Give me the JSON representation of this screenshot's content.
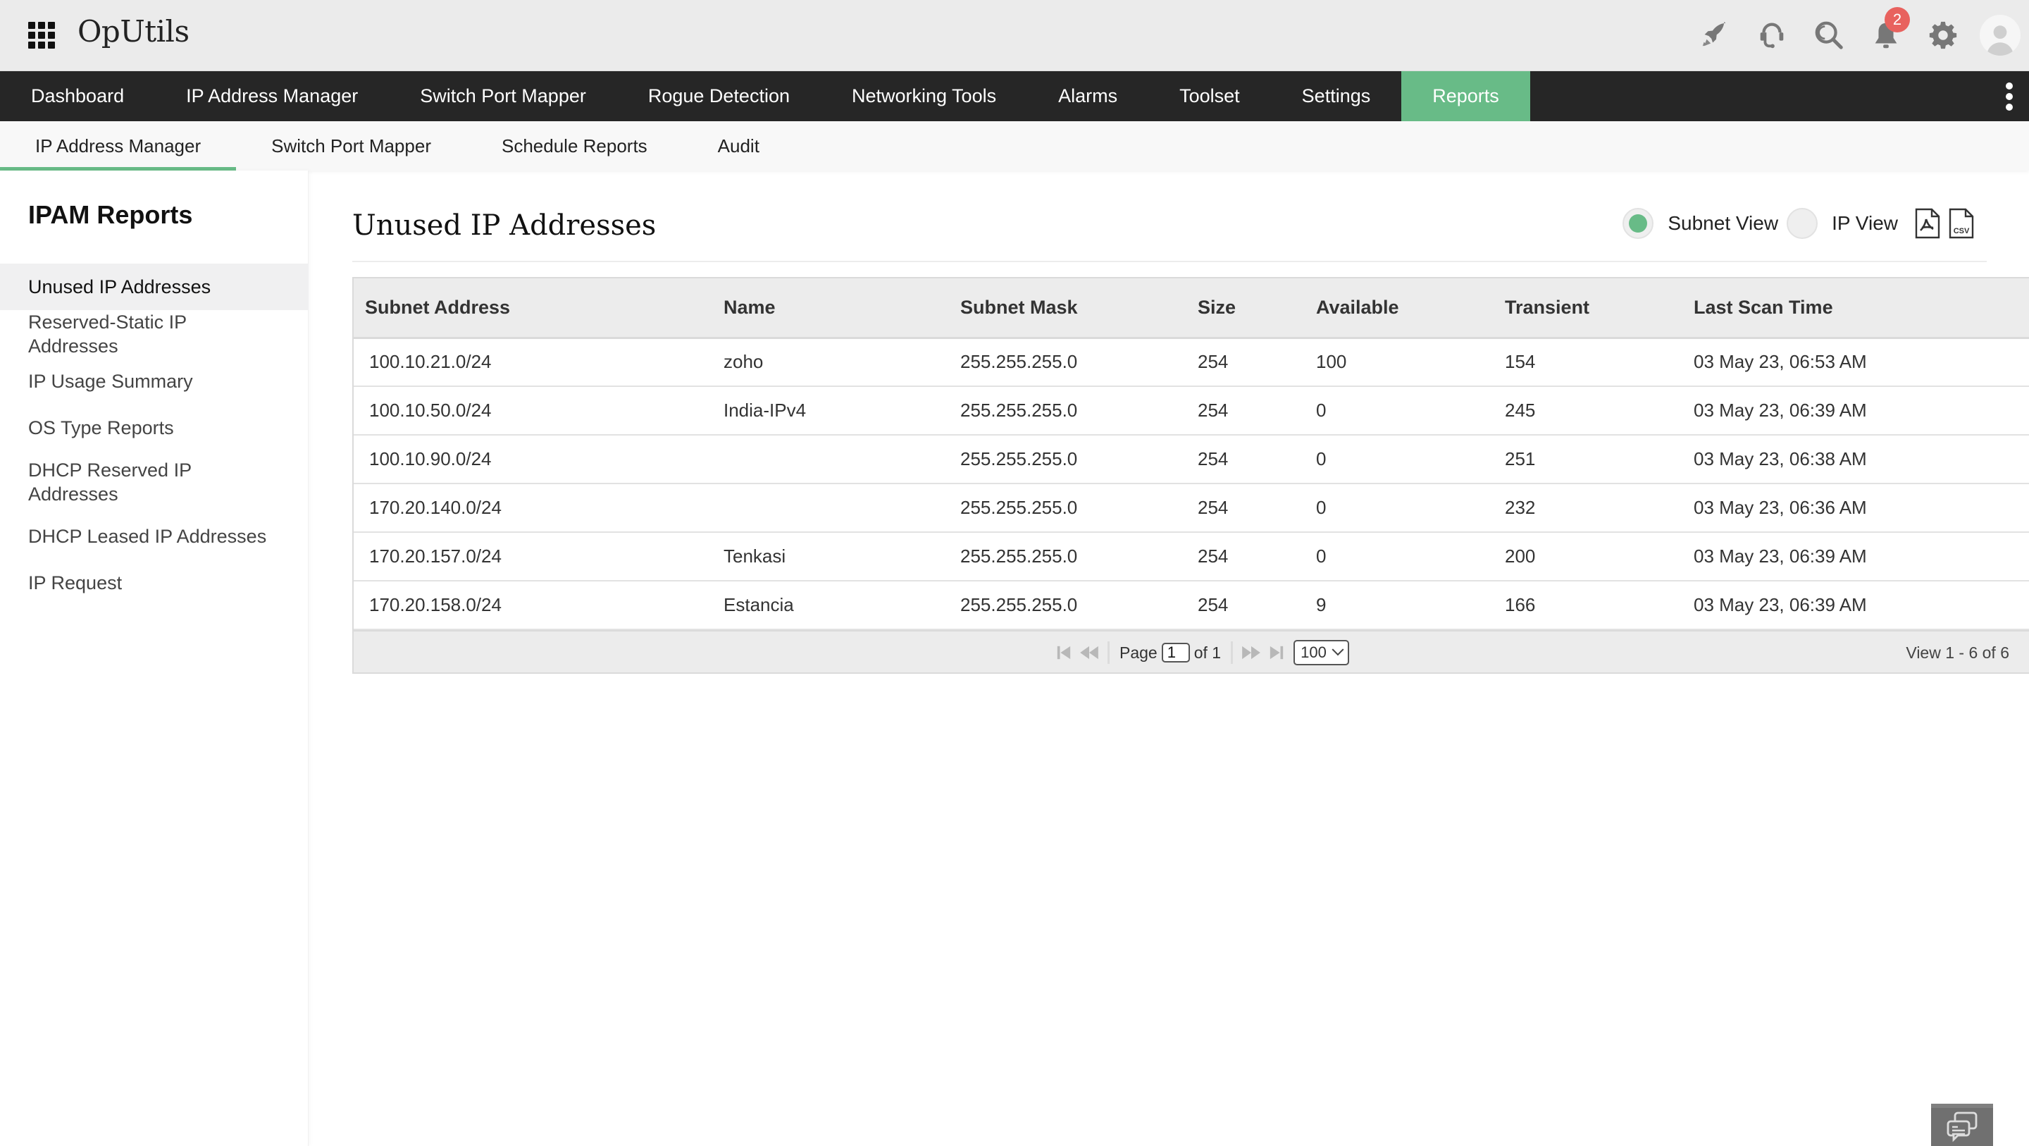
{
  "app": {
    "title": "OpUtils",
    "notification_count": "2",
    "top_icons": [
      "rocket-icon",
      "headset-icon",
      "search-icon",
      "bell-icon",
      "gear-icon",
      "user-avatar"
    ]
  },
  "main_nav": {
    "items": [
      {
        "label": "Dashboard",
        "active": false
      },
      {
        "label": "IP Address Manager",
        "active": false
      },
      {
        "label": "Switch Port Mapper",
        "active": false
      },
      {
        "label": "Rogue Detection",
        "active": false
      },
      {
        "label": "Networking Tools",
        "active": false
      },
      {
        "label": "Alarms",
        "active": false
      },
      {
        "label": "Toolset",
        "active": false
      },
      {
        "label": "Settings",
        "active": false
      },
      {
        "label": "Reports",
        "active": true
      }
    ]
  },
  "sub_nav": {
    "items": [
      {
        "label": "IP Address Manager",
        "active": true
      },
      {
        "label": "Switch Port Mapper",
        "active": false
      },
      {
        "label": "Schedule Reports",
        "active": false
      },
      {
        "label": "Audit",
        "active": false
      }
    ]
  },
  "sidebar": {
    "title": "IPAM Reports",
    "items": [
      {
        "label": "Unused IP Addresses",
        "active": true
      },
      {
        "label": "Reserved-Static IP Addresses",
        "active": false
      },
      {
        "label": "IP Usage Summary",
        "active": false
      },
      {
        "label": "OS Type Reports",
        "active": false
      },
      {
        "label": "DHCP Reserved IP Addresses",
        "active": false
      },
      {
        "label": "DHCP Leased IP Addresses",
        "active": false
      },
      {
        "label": "IP Request",
        "active": false
      }
    ]
  },
  "content": {
    "title": "Unused IP Addresses",
    "view_options": {
      "subnet_view_label": "Subnet View",
      "ip_view_label": "IP View",
      "selected": "Subnet View"
    },
    "export": {
      "pdf": "pdf-export",
      "csv_label": "CSV"
    }
  },
  "table": {
    "columns": [
      "Subnet Address",
      "Name",
      "Subnet Mask",
      "Size",
      "Available",
      "Transient",
      "Last Scan Time"
    ],
    "rows": [
      [
        "100.10.21.0/24",
        "zoho",
        "255.255.255.0",
        "254",
        "100",
        "154",
        "03 May 23, 06:53 AM"
      ],
      [
        "100.10.50.0/24",
        "India-IPv4",
        "255.255.255.0",
        "254",
        "0",
        "245",
        "03 May 23, 06:39 AM"
      ],
      [
        "100.10.90.0/24",
        "",
        "255.255.255.0",
        "254",
        "0",
        "251",
        "03 May 23, 06:38 AM"
      ],
      [
        "170.20.140.0/24",
        "",
        "255.255.255.0",
        "254",
        "0",
        "232",
        "03 May 23, 06:36 AM"
      ],
      [
        "170.20.157.0/24",
        "Tenkasi",
        "255.255.255.0",
        "254",
        "0",
        "200",
        "03 May 23, 06:39 AM"
      ],
      [
        "170.20.158.0/24",
        "Estancia",
        "255.255.255.0",
        "254",
        "9",
        "166",
        "03 May 23, 06:39 AM"
      ]
    ]
  },
  "pagination": {
    "page_label": "Page",
    "current_page": "1",
    "of_label": "of 1",
    "page_size": "100",
    "view_count": "View 1 - 6 of 6"
  },
  "colors": {
    "accent": "#68bb87",
    "nav_bg": "#262626",
    "badge": "#e8625e"
  }
}
